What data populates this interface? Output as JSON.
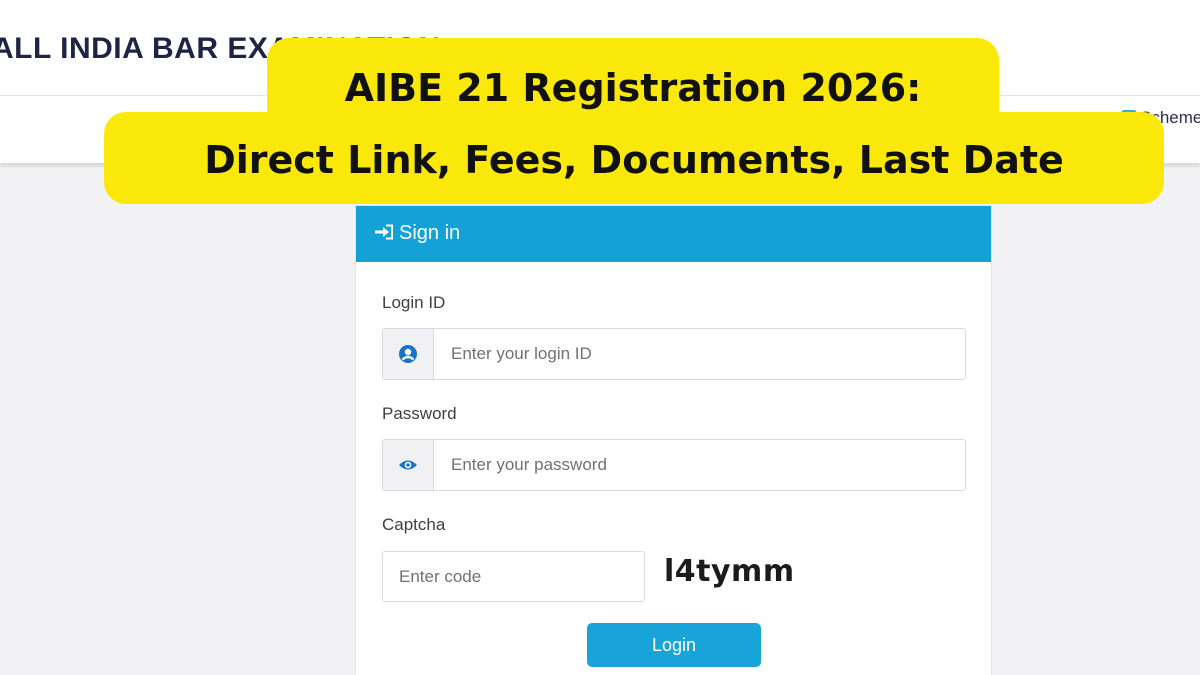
{
  "site": {
    "title": "ALL INDIA BAR EXAMINATION",
    "nav_right_label": "Scheme"
  },
  "headline": {
    "line1": "AIBE 21 Registration 2026:",
    "line2": "Direct Link, Fees, Documents, Last Date",
    "bg_color": "#fbe80b"
  },
  "signin": {
    "header": "Sign in",
    "header_color": "#13a1d6",
    "login_id": {
      "label": "Login ID",
      "placeholder": "Enter your login ID",
      "icon": "user-circle-icon"
    },
    "password": {
      "label": "Password",
      "placeholder": "Enter your password",
      "icon": "eye-icon"
    },
    "captcha": {
      "label": "Captcha",
      "placeholder": "Enter code",
      "code": "l4tymm"
    },
    "login_button": "Login"
  }
}
